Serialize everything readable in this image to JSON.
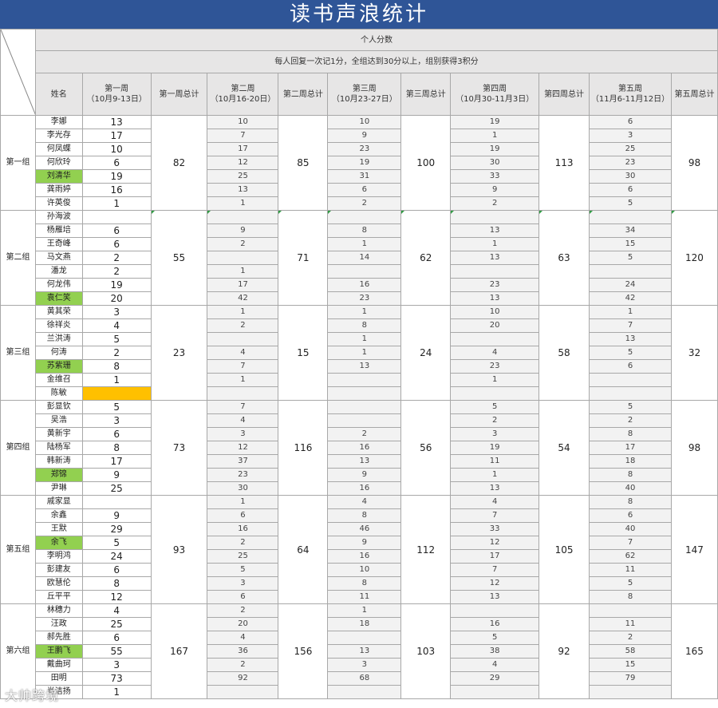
{
  "title": "读书声浪统计",
  "header": {
    "personal_score": "个人分数",
    "rule": "每人回复一次记1分，全组达到30分以上，组别获得3积分",
    "name_col": "姓名",
    "weeks": [
      {
        "label": "第一周",
        "dates": "（10月9-13日）",
        "total_label": "第一周总计"
      },
      {
        "label": "第二周",
        "dates": "（10月16-20日）",
        "total_label": "第二周总计"
      },
      {
        "label": "第三周",
        "dates": "（10月23-27日）",
        "total_label": "第三周总计"
      },
      {
        "label": "第四周",
        "dates": "（10月30-11月3日）",
        "total_label": "第四周总计"
      },
      {
        "label": "第五周",
        "dates": "（11月6-11月12日）",
        "total_label": "第五周总计"
      }
    ]
  },
  "groups": [
    {
      "name": "第一组",
      "totals": [
        "82",
        "85",
        "100",
        "113",
        "98"
      ],
      "members": [
        {
          "name": "李娜",
          "scores": [
            "13",
            "10",
            "10",
            "19",
            "6"
          ]
        },
        {
          "name": "李光存",
          "scores": [
            "17",
            "7",
            "9",
            "1",
            "3"
          ]
        },
        {
          "name": "何凤蝶",
          "scores": [
            "10",
            "17",
            "23",
            "19",
            "25"
          ]
        },
        {
          "name": "何欣玲",
          "scores": [
            "6",
            "12",
            "19",
            "30",
            "23"
          ]
        },
        {
          "name": "刘清华",
          "scores": [
            "19",
            "25",
            "31",
            "33",
            "30"
          ],
          "leader": true
        },
        {
          "name": "龚雨婷",
          "scores": [
            "16",
            "13",
            "6",
            "9",
            "6"
          ]
        },
        {
          "name": "许英俊",
          "scores": [
            "1",
            "1",
            "2",
            "2",
            "5"
          ]
        }
      ]
    },
    {
      "name": "第二组",
      "totals": [
        "55",
        "71",
        "62",
        "63",
        "120"
      ],
      "members": [
        {
          "name": "孙海波",
          "scores": [
            "",
            "",
            "",
            "",
            ""
          ]
        },
        {
          "name": "杨雁培",
          "scores": [
            "6",
            "9",
            "8",
            "13",
            "34"
          ]
        },
        {
          "name": "王奇峰",
          "scores": [
            "6",
            "2",
            "1",
            "1",
            "15"
          ]
        },
        {
          "name": "马文燕",
          "scores": [
            "2",
            "",
            "14",
            "13",
            "5"
          ]
        },
        {
          "name": "潘龙",
          "scores": [
            "2",
            "1",
            "",
            "",
            ""
          ]
        },
        {
          "name": "何龙伟",
          "scores": [
            "19",
            "17",
            "16",
            "23",
            "24"
          ]
        },
        {
          "name": "袁仁笑",
          "scores": [
            "20",
            "42",
            "23",
            "13",
            "42"
          ],
          "leader": true
        }
      ]
    },
    {
      "name": "第三组",
      "totals": [
        "23",
        "15",
        "24",
        "58",
        "32"
      ],
      "members": [
        {
          "name": "黄其荣",
          "scores": [
            "3",
            "1",
            "1",
            "10",
            "1"
          ]
        },
        {
          "name": "徐祥炎",
          "scores": [
            "4",
            "2",
            "8",
            "20",
            "7"
          ]
        },
        {
          "name": "兰洪涛",
          "scores": [
            "5",
            "",
            "1",
            "",
            "13"
          ]
        },
        {
          "name": "何涛",
          "scores": [
            "2",
            "4",
            "1",
            "4",
            "5"
          ]
        },
        {
          "name": "苏紫珊",
          "scores": [
            "8",
            "7",
            "13",
            "23",
            "6"
          ],
          "leader": true
        },
        {
          "name": "金维召",
          "scores": [
            "1",
            "1",
            "",
            "1",
            ""
          ]
        },
        {
          "name": "陈敏",
          "scores": [
            "",
            "",
            "",
            "",
            ""
          ],
          "missing": true
        }
      ]
    },
    {
      "name": "第四组",
      "totals": [
        "73",
        "116",
        "56",
        "54",
        "98"
      ],
      "members": [
        {
          "name": "彭显钦",
          "scores": [
            "5",
            "7",
            "",
            "5",
            "5"
          ]
        },
        {
          "name": "吴浩",
          "scores": [
            "3",
            "4",
            "",
            "2",
            "2"
          ]
        },
        {
          "name": "黄新宇",
          "scores": [
            "6",
            "3",
            "2",
            "3",
            "8"
          ]
        },
        {
          "name": "陆杨军",
          "scores": [
            "8",
            "12",
            "16",
            "19",
            "17"
          ]
        },
        {
          "name": "韩新涛",
          "scores": [
            "17",
            "37",
            "13",
            "11",
            "18"
          ]
        },
        {
          "name": "郑锦",
          "scores": [
            "9",
            "23",
            "9",
            "1",
            "8"
          ],
          "leader": true
        },
        {
          "name": "尹琳",
          "scores": [
            "25",
            "30",
            "16",
            "13",
            "40"
          ]
        }
      ]
    },
    {
      "name": "第五组",
      "totals": [
        "93",
        "64",
        "112",
        "105",
        "147"
      ],
      "members": [
        {
          "name": "戚家显",
          "scores": [
            "",
            "1",
            "4",
            "4",
            "8"
          ]
        },
        {
          "name": "余鑫",
          "scores": [
            "9",
            "6",
            "8",
            "7",
            "6"
          ]
        },
        {
          "name": "王默",
          "scores": [
            "29",
            "16",
            "46",
            "33",
            "40"
          ]
        },
        {
          "name": "余飞",
          "scores": [
            "5",
            "2",
            "9",
            "12",
            "7"
          ],
          "leader": true
        },
        {
          "name": "李明鸿",
          "scores": [
            "24",
            "25",
            "16",
            "17",
            "62"
          ]
        },
        {
          "name": "彭建友",
          "scores": [
            "6",
            "5",
            "10",
            "7",
            "11"
          ]
        },
        {
          "name": "欧慧伦",
          "scores": [
            "8",
            "3",
            "8",
            "12",
            "5"
          ]
        },
        {
          "name": "丘平平",
          "scores": [
            "12",
            "6",
            "11",
            "13",
            "8"
          ]
        }
      ]
    },
    {
      "name": "第六组",
      "totals": [
        "167",
        "156",
        "103",
        "92",
        "165"
      ],
      "members": [
        {
          "name": "林穗力",
          "scores": [
            "4",
            "2",
            "1",
            "",
            ""
          ]
        },
        {
          "name": "汪政",
          "scores": [
            "25",
            "20",
            "18",
            "16",
            "11"
          ]
        },
        {
          "name": "郝先胜",
          "scores": [
            "6",
            "4",
            "",
            "5",
            "2"
          ]
        },
        {
          "name": "王鹏飞",
          "scores": [
            "55",
            "36",
            "13",
            "38",
            "58"
          ],
          "leader": true
        },
        {
          "name": "戴曲珂",
          "scores": [
            "3",
            "2",
            "3",
            "4",
            "15"
          ]
        },
        {
          "name": "田明",
          "scores": [
            "73",
            "92",
            "68",
            "29",
            "79"
          ]
        },
        {
          "name": "肖洁扬",
          "scores": [
            "1",
            "",
            "",
            "",
            ""
          ]
        }
      ]
    }
  ],
  "watermark": "大帅跨境",
  "colors": {
    "title_bg": "#2f5597",
    "header_bg": "#e7e6e6",
    "score_bg": "#f2f2f2",
    "leader_bg": "#92d050",
    "missing_bg": "#ffc000"
  }
}
